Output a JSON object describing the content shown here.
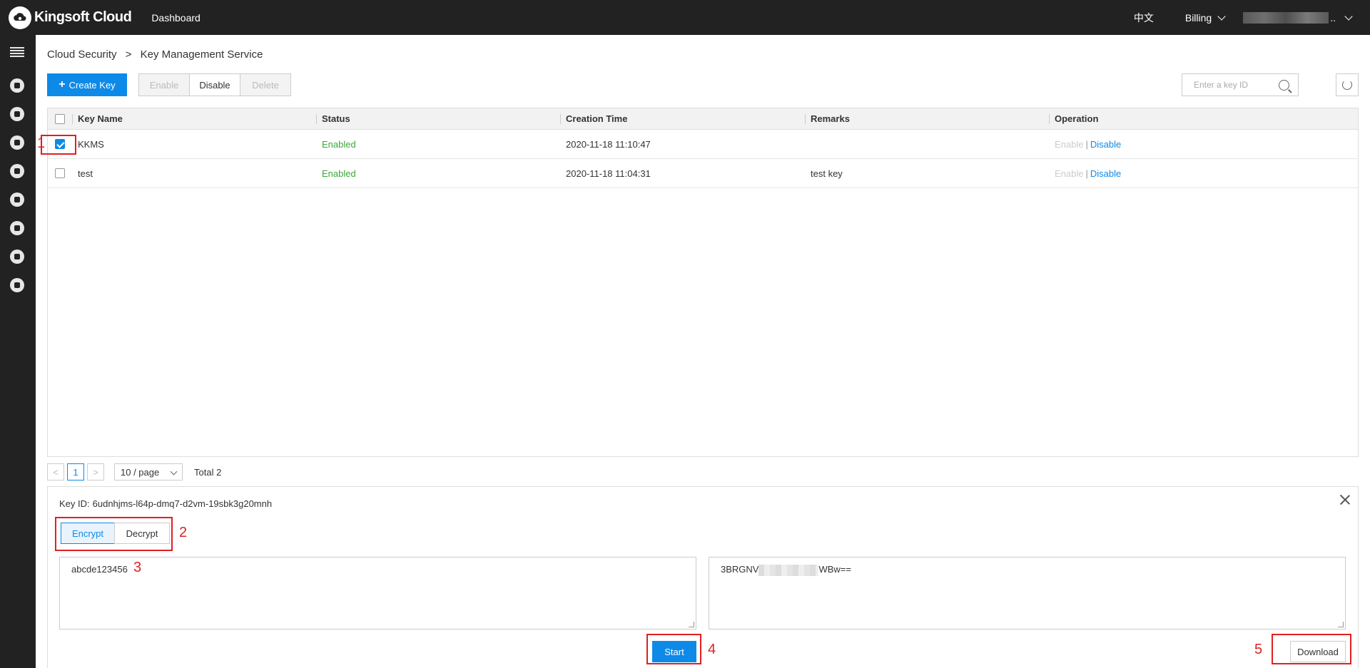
{
  "header": {
    "brand": "Kingsoft Cloud",
    "nav_dashboard": "Dashboard",
    "lang": "中文",
    "billing": "Billing",
    "user_suffix": ".."
  },
  "sidebar": {
    "icons": [
      "menu-icon",
      "shield-icon",
      "user-badge-icon",
      "server-list-icon",
      "database-icon",
      "support-icon",
      "network-icon",
      "cloud-icon",
      "id-card-icon"
    ]
  },
  "breadcrumb": {
    "parent": "Cloud Security",
    "separator": ">",
    "current": "Key Management Service"
  },
  "toolbar": {
    "create_label": "Create Key",
    "enable_label": "Enable",
    "disable_label": "Disable",
    "delete_label": "Delete",
    "search_placeholder": "Enter a key ID"
  },
  "table": {
    "columns": {
      "name": "Key Name",
      "status": "Status",
      "created": "Creation Time",
      "remarks": "Remarks",
      "operation": "Operation"
    },
    "rows": [
      {
        "name": "KKMS",
        "status": "Enabled",
        "created": "2020-11-18 11:10:47",
        "remarks": "",
        "op_enable": "Enable",
        "op_sep": "|",
        "op_disable": "Disable",
        "checked": true
      },
      {
        "name": "test",
        "status": "Enabled",
        "created": "2020-11-18 11:04:31",
        "remarks": "test key",
        "op_enable": "Enable",
        "op_sep": "|",
        "op_disable": "Disable",
        "checked": false
      }
    ]
  },
  "pagination": {
    "prev": "<",
    "page": "1",
    "next": ">",
    "page_size": "10 / page",
    "total": "Total 2"
  },
  "panel": {
    "key_id_label": "Key ID:",
    "key_id_value": "6udnhjms-l64p-dmq7-d2vm-19sbk3g20mnh",
    "tab_encrypt": "Encrypt",
    "tab_decrypt": "Decrypt",
    "input_text": "abcde123456",
    "output_prefix": "3BRGNV",
    "output_suffix": "WBw==",
    "start_label": "Start",
    "download_label": "Download"
  },
  "annotations": [
    "1",
    "2",
    "3",
    "4",
    "5"
  ],
  "colors": {
    "accent": "#0d8ae8",
    "enabled_status": "#3aa83a",
    "annotation": "#e02020",
    "topbar": "#222222"
  }
}
